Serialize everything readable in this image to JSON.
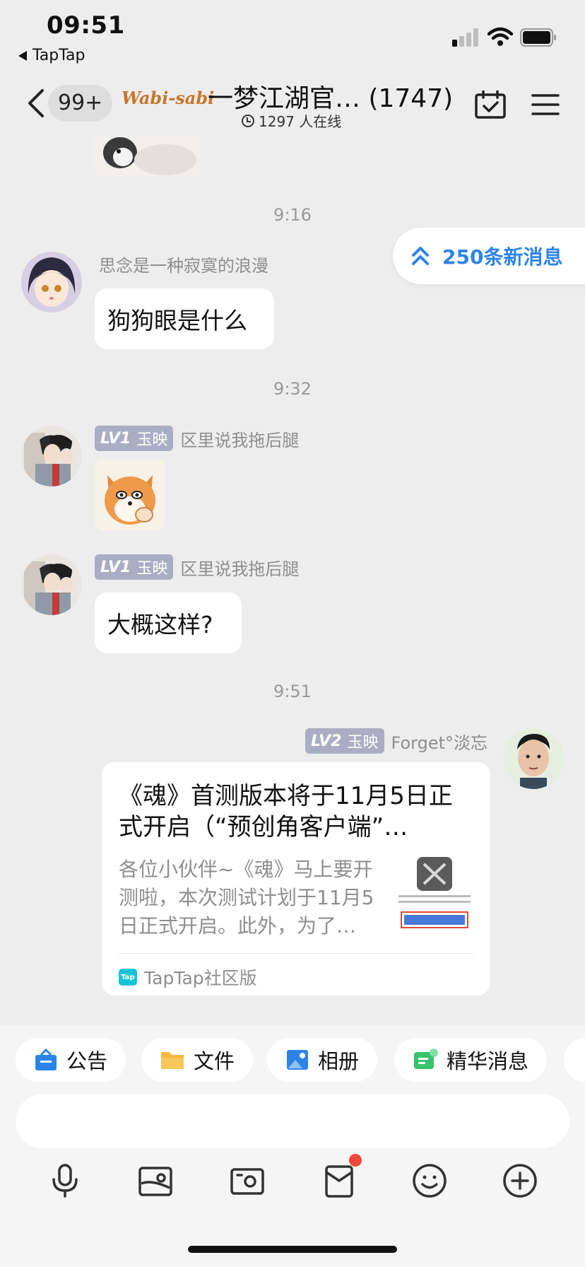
{
  "status_bar": {
    "time": "09:51",
    "back_app": "TapTap"
  },
  "nav": {
    "unread_count": "99+",
    "brand_logo": "Wabi-sabi",
    "group_title": "一梦江湖官… (1747)",
    "online_text": "1297 人在线"
  },
  "new_messages_pill": "250条新消息",
  "messages": [
    {
      "timestamp": "9:16"
    },
    {
      "sender": "思念是一种寂寞的浪漫",
      "text": "狗狗眼是什么"
    },
    {
      "timestamp": "9:32"
    },
    {
      "level": "LV1",
      "title": "玉映",
      "sender": "区里说我拖后腿",
      "type": "sticker"
    },
    {
      "level": "LV1",
      "title": "玉映",
      "sender": "区里说我拖后腿",
      "text": "大概这样?"
    },
    {
      "timestamp": "9:51"
    },
    {
      "level": "LV2",
      "title": "玉映",
      "sender": "Forget°淡忘",
      "type": "share-card"
    }
  ],
  "share_card": {
    "title": "《魂》首测版本将于11月5日正式开启（“预创角客户端”…",
    "description": "各位小伙伴~《魂》马上要开测啦，本次测试计划于11月5日正式开启。此外，为了…",
    "source": "TapTap社区版",
    "source_logo": "Tap"
  },
  "quick_chips": [
    {
      "label": "公告",
      "icon": "announcement-icon",
      "color": "#2D84E8"
    },
    {
      "label": "文件",
      "icon": "folder-icon",
      "color": "#F5B640"
    },
    {
      "label": "相册",
      "icon": "album-icon",
      "color": "#2D84E8"
    },
    {
      "label": "精华消息",
      "icon": "essence-icon",
      "color": "#35C36B"
    }
  ],
  "toolbar": {
    "icons": [
      "microphone-icon",
      "image-icon",
      "camera-icon",
      "red-packet-icon",
      "emoji-icon",
      "plus-icon"
    ],
    "badge_color": "#F0473A"
  },
  "colors": {
    "accent": "#2D84E8",
    "background": "#EDEDED",
    "level_badge": "#A9AEC4"
  }
}
